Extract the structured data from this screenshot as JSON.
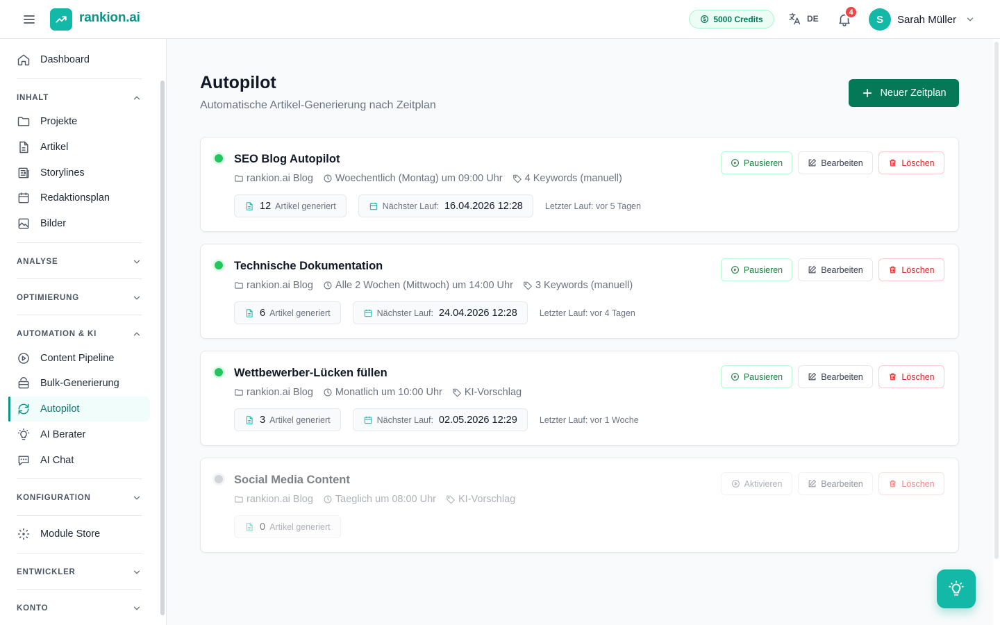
{
  "brand": {
    "name": "rankion.ai",
    "color": "#14b8a6",
    "icon": "trending-up-icon"
  },
  "header": {
    "credits": "5000 Credits",
    "language": "DE",
    "notifications_count": "4",
    "user": {
      "initial": "S",
      "name": "Sarah Müller"
    }
  },
  "sidebar": {
    "top": {
      "label": "Dashboard",
      "icon": "home-icon"
    },
    "sections": {
      "inhalt": {
        "label": "INHALT",
        "expanded": true,
        "items": [
          {
            "label": "Projekte",
            "icon": "folder-icon"
          },
          {
            "label": "Artikel",
            "icon": "file-text-icon"
          },
          {
            "label": "Storylines",
            "icon": "newspaper-icon"
          },
          {
            "label": "Redaktionsplan",
            "icon": "calendar-icon"
          },
          {
            "label": "Bilder",
            "icon": "image-icon"
          }
        ]
      },
      "analyse": {
        "label": "ANALYSE",
        "expanded": false
      },
      "optimierung": {
        "label": "OPTIMIERUNG",
        "expanded": false
      },
      "automation": {
        "label": "AUTOMATION & KI",
        "expanded": true,
        "items": [
          {
            "label": "Content Pipeline",
            "icon": "play-circle-icon"
          },
          {
            "label": "Bulk-Generierung",
            "icon": "layers-icon"
          },
          {
            "label": "Autopilot",
            "icon": "refresh-icon",
            "active": true
          },
          {
            "label": "AI Berater",
            "icon": "lightbulb-icon"
          },
          {
            "label": "AI Chat",
            "icon": "chat-icon"
          }
        ]
      },
      "konfiguration": {
        "label": "KONFIGURATION",
        "expanded": false
      },
      "module_store": {
        "label": "Module Store",
        "icon": "puzzle-icon"
      },
      "entwickler": {
        "label": "ENTWICKLER",
        "expanded": false
      },
      "konto": {
        "label": "KONTO",
        "expanded": false
      }
    }
  },
  "page": {
    "title": "Autopilot",
    "subtitle": "Automatische Artikel-Generierung nach Zeitplan",
    "new_button": "Neuer Zeitplan"
  },
  "labels": {
    "generated": "Artikel generiert",
    "next_run": "Nächster Lauf:",
    "pause": "Pausieren",
    "activate": "Aktivieren",
    "edit": "Bearbeiten",
    "delete": "Löschen"
  },
  "schedules": [
    {
      "name": "SEO Blog Autopilot",
      "active": true,
      "project": "rankion.ai Blog",
      "frequency": "Woechentlich (Montag) um 09:00 Uhr",
      "keywords": "4 Keywords (manuell)",
      "generated_count": "12",
      "next_run": "16.04.2026 12:28",
      "last_run": "Letzter Lauf: vor 5 Tagen"
    },
    {
      "name": "Technische Dokumentation",
      "active": true,
      "project": "rankion.ai Blog",
      "frequency": "Alle 2 Wochen (Mittwoch) um 14:00 Uhr",
      "keywords": "3 Keywords (manuell)",
      "generated_count": "6",
      "next_run": "24.04.2026 12:28",
      "last_run": "Letzter Lauf: vor 4 Tagen"
    },
    {
      "name": "Wettbewerber-Lücken füllen",
      "active": true,
      "project": "rankion.ai Blog",
      "frequency": "Monatlich um 10:00 Uhr",
      "keywords": "KI-Vorschlag",
      "generated_count": "3",
      "next_run": "02.05.2026 12:29",
      "last_run": "Letzter Lauf: vor 1 Woche"
    },
    {
      "name": "Social Media Content",
      "active": false,
      "project": "rankion.ai Blog",
      "frequency": "Taeglich um 08:00 Uhr",
      "keywords": "KI-Vorschlag",
      "generated_count": "0"
    }
  ],
  "colors": {
    "accent": "#14b8a6",
    "primary_button": "#047857",
    "active_dot": "#22c55e",
    "danger": "#dc2626",
    "badge": "#ef4444"
  }
}
